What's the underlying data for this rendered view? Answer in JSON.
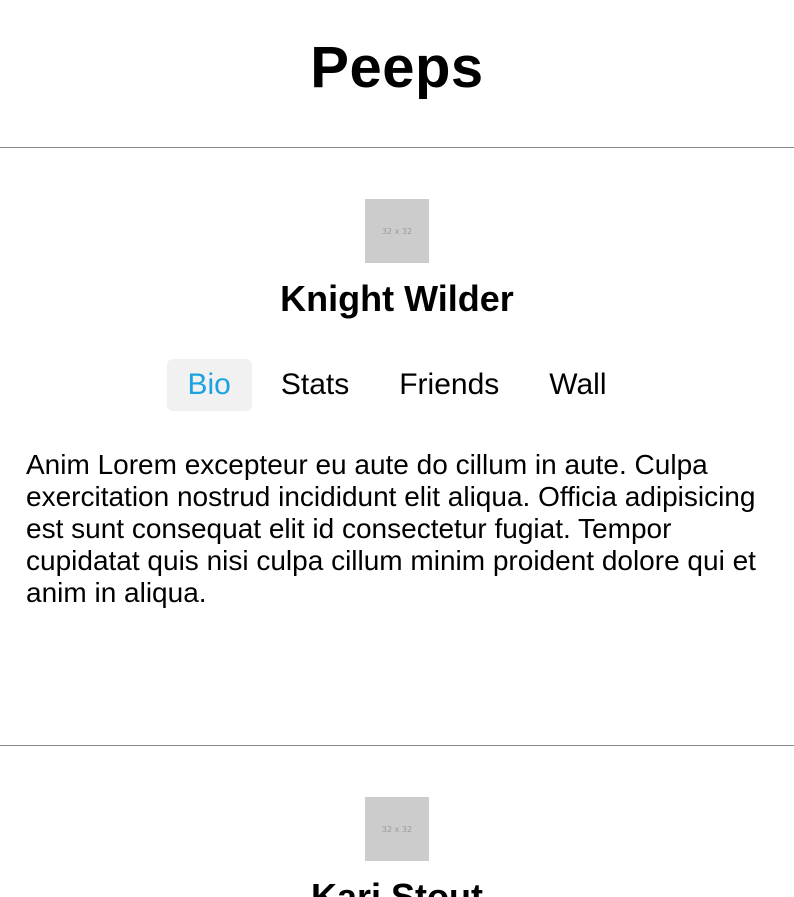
{
  "header": {
    "title": "Peeps"
  },
  "profiles": [
    {
      "avatar_text": "32 x 32",
      "name": "Knight Wilder",
      "tabs": [
        "Bio",
        "Stats",
        "Friends",
        "Wall"
      ],
      "active_tab": "Bio",
      "bio": "Anim Lorem excepteur eu aute do cillum in aute. Culpa exercitation nostrud incididunt elit aliqua. Officia adipisicing est sunt consequat elit id consectetur fugiat. Tempor cupidatat quis nisi culpa cillum minim proident dolore qui et anim in aliqua."
    },
    {
      "avatar_text": "32 x 32",
      "name": "Kari Stout"
    }
  ],
  "colors": {
    "active_tab_text": "#1aa3e0",
    "active_tab_bg": "#f1f1f1",
    "avatar_placeholder": "#cccccc",
    "divider": "#8a8a8a"
  }
}
